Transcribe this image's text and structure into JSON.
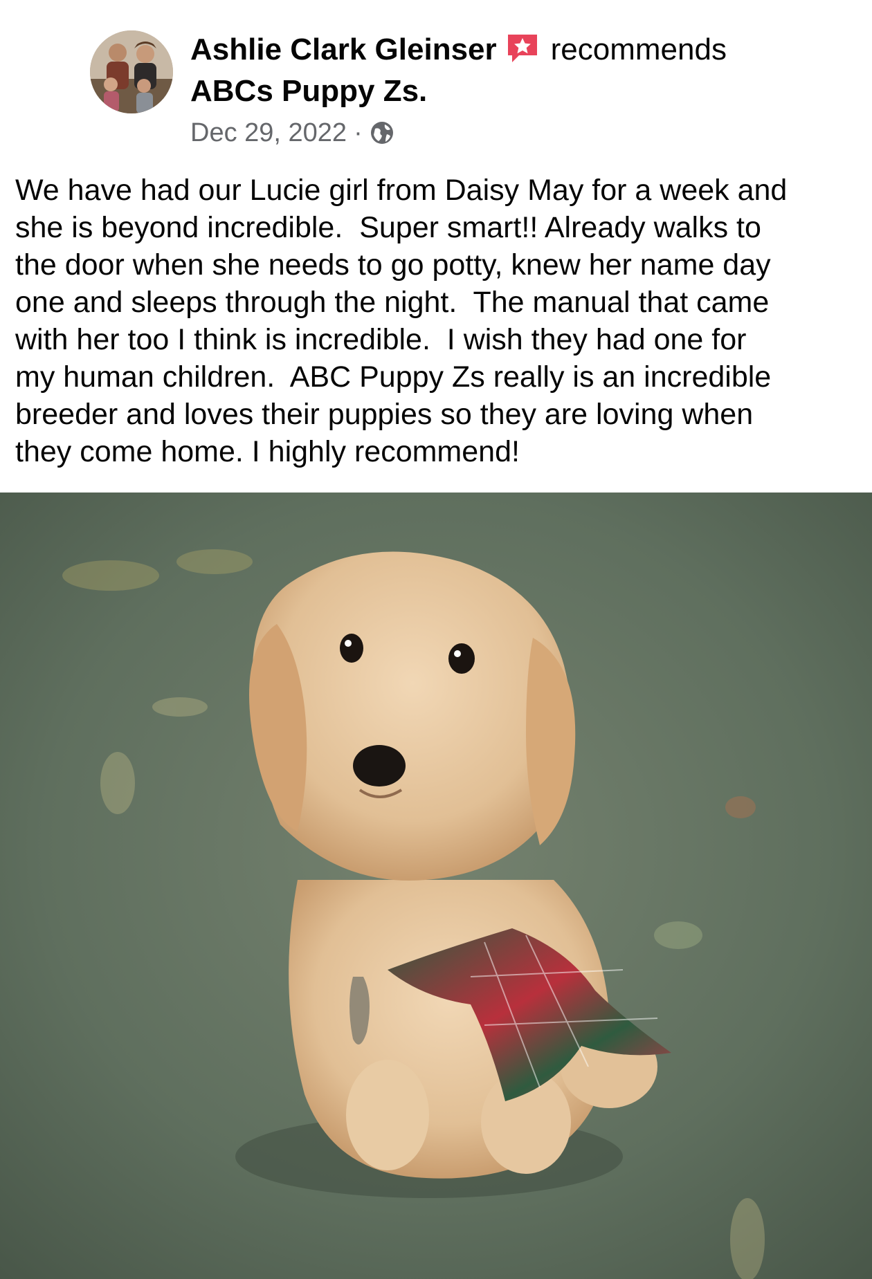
{
  "post": {
    "author": "Ashlie Clark Gleinser",
    "verb": "recommends",
    "page_name": "ABCs Puppy Zs.",
    "date": "Dec 29, 2022",
    "separator": "·",
    "audience_icon": "globe-icon",
    "recommend_icon": "recommend-star-icon",
    "body": "We have had our Lucie girl from Daisy May for a week and\nshe is beyond incredible.  Super smart!! Already walks to\nthe door when she needs to go potty, knew her name day\none and sleeps through the night.  The manual that came\nwith her too I think is incredible.  I wish they had one for\nmy human children.  ABC Puppy Zs really is an incredible\nbreeder and loves their puppies so they are loving when\nthey come home. I highly recommend!"
  },
  "colors": {
    "recommend_accent": "#e8435a",
    "meta_text": "#65676b",
    "text": "#050505",
    "grass": "#5f6f5e",
    "puppy": "#e3c29a"
  }
}
